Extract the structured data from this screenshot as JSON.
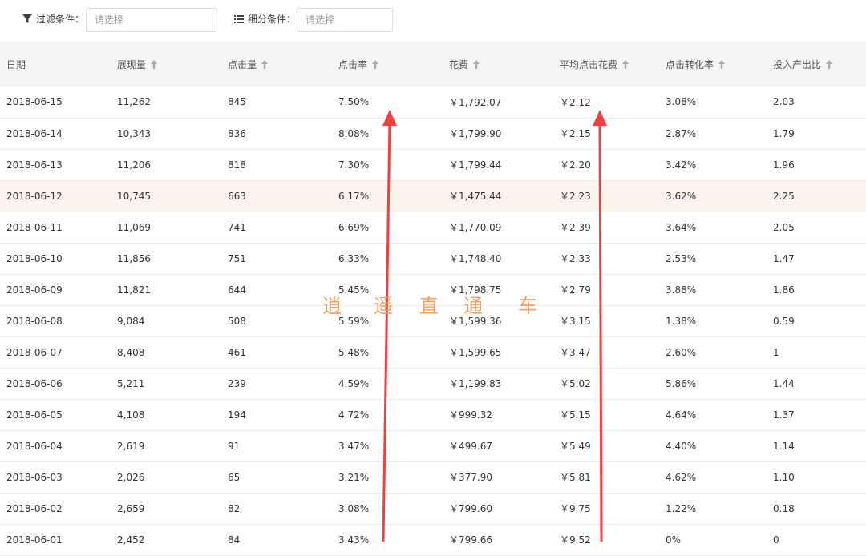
{
  "filters": {
    "filter_label": "过滤条件：",
    "filter_placeholder": "请选择",
    "segment_label": "细分条件：",
    "segment_placeholder": "请选择"
  },
  "table": {
    "headers": [
      "日期",
      "展现量",
      "点击量",
      "点击率",
      "花费",
      "平均点击花费",
      "点击转化率",
      "投入产出比"
    ],
    "rows": [
      [
        "2018-06-15",
        "11,262",
        "845",
        "7.50%",
        "￥1,792.07",
        "￥2.12",
        "3.08%",
        "2.03"
      ],
      [
        "2018-06-14",
        "10,343",
        "836",
        "8.08%",
        "￥1,799.90",
        "￥2.15",
        "2.87%",
        "1.79"
      ],
      [
        "2018-06-13",
        "11,206",
        "818",
        "7.30%",
        "￥1,799.44",
        "￥2.20",
        "3.42%",
        "1.96"
      ],
      [
        "2018-06-12",
        "10,745",
        "663",
        "6.17%",
        "￥1,475.44",
        "￥2.23",
        "3.62%",
        "2.25"
      ],
      [
        "2018-06-11",
        "11,069",
        "741",
        "6.69%",
        "￥1,770.09",
        "￥2.39",
        "3.64%",
        "2.05"
      ],
      [
        "2018-06-10",
        "11,856",
        "751",
        "6.33%",
        "￥1,748.40",
        "￥2.33",
        "2.53%",
        "1.47"
      ],
      [
        "2018-06-09",
        "11,821",
        "644",
        "5.45%",
        "￥1,798.75",
        "￥2.79",
        "3.88%",
        "1.86"
      ],
      [
        "2018-06-08",
        "9,084",
        "508",
        "5.59%",
        "￥1,599.36",
        "￥3.15",
        "1.38%",
        "0.59"
      ],
      [
        "2018-06-07",
        "8,408",
        "461",
        "5.48%",
        "￥1,599.65",
        "￥3.47",
        "2.60%",
        "1"
      ],
      [
        "2018-06-06",
        "5,211",
        "239",
        "4.59%",
        "￥1,199.83",
        "￥5.02",
        "5.86%",
        "1.44"
      ],
      [
        "2018-06-05",
        "4,108",
        "194",
        "4.72%",
        "￥999.32",
        "￥5.15",
        "4.64%",
        "1.37"
      ],
      [
        "2018-06-04",
        "2,619",
        "91",
        "3.47%",
        "￥499.67",
        "￥5.49",
        "4.40%",
        "1.14"
      ],
      [
        "2018-06-03",
        "2,026",
        "65",
        "3.21%",
        "￥377.90",
        "￥5.81",
        "4.62%",
        "1.10"
      ],
      [
        "2018-06-02",
        "2,659",
        "82",
        "3.08%",
        "￥799.60",
        "￥9.75",
        "1.22%",
        "0.18"
      ],
      [
        "2018-06-01",
        "2,452",
        "84",
        "3.43%",
        "￥799.66",
        "￥9.52",
        "0%",
        "0"
      ]
    ],
    "highlight_row": 3
  },
  "watermark": [
    "逍",
    "遥",
    "直",
    "通",
    "车"
  ],
  "colors": {
    "header_bg": "#f5f5f5",
    "highlight_bg": "#fbf3ec",
    "arrow": "#f04040",
    "watermark": "#f0a060"
  },
  "icons": {
    "filter": "funnel-icon",
    "segment": "list-icon",
    "sort": "sort-up-arrow-icon"
  }
}
